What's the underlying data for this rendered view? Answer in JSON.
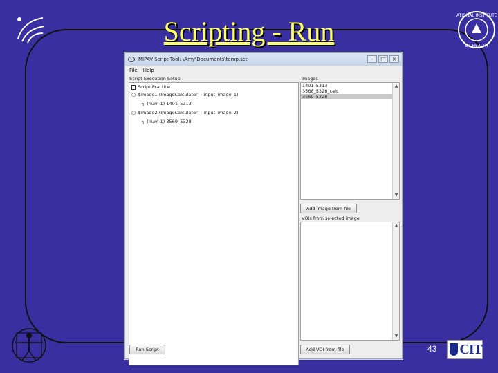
{
  "slide": {
    "title": "Scripting - Run",
    "slide_number": "43",
    "logo_cit_text": "CIT"
  },
  "window": {
    "title": "MIPAV Script Tool: \\Amy\\Documents\\temp.sct",
    "controls": [
      "–",
      "□",
      "×"
    ]
  },
  "menu": [
    "File",
    "Help"
  ],
  "script_setup": {
    "label": "Script Execution Setup",
    "tree": [
      {
        "glyph": "□",
        "label": "Script Practice"
      },
      {
        "glyph": "○",
        "label": "$image1 (ImageCalculator -- input_image_1)"
      },
      {
        "glyph": "┐",
        "label": "(num-1) 1401_5313"
      },
      {
        "glyph": "○",
        "label": "$image2 (ImageCalculator -- input_image_2)"
      },
      {
        "glyph": "┐",
        "label": "(num-1) 3569_5328"
      }
    ]
  },
  "images": {
    "label": "Images",
    "items": [
      "1401_5313",
      "3568_5328_calc",
      "3569_5328"
    ],
    "selected_index": 2,
    "add_button": "Add image from file"
  },
  "vois": {
    "label": "VOIs from selected image",
    "add_button": "Add VOI from file"
  },
  "run_button": "Run Script",
  "icons": {
    "title": "eye-icon",
    "tree_root": "script-icon",
    "tree_node": "node-icon",
    "tree_leaf": "image-leaf-icon"
  }
}
